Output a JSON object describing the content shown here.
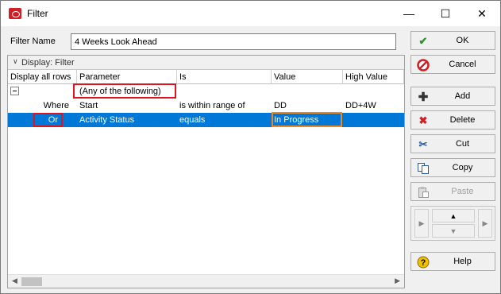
{
  "window": {
    "title": "Filter",
    "minimize_glyph": "—",
    "maximize_glyph": "☐",
    "close_glyph": "✕",
    "accent": "#0078d7"
  },
  "form": {
    "filter_name_label": "Filter Name",
    "filter_name_value": "4 Weeks Look Ahead"
  },
  "panel": {
    "header": "Display: Filter",
    "columns": [
      "Display all rows",
      "Parameter",
      "Is",
      "Value",
      "High Value"
    ],
    "rows": [
      {
        "group_label": "(Any of the following)"
      },
      {
        "conj": "Where",
        "parameter": "Start",
        "is": "is within range of",
        "value": "DD",
        "high_value": "DD+4W"
      },
      {
        "conj": "Or",
        "parameter": "Activity Status",
        "is": "equals",
        "value": "In Progress",
        "high_value": "",
        "selected": true
      }
    ]
  },
  "buttons": {
    "ok": "OK",
    "cancel": "Cancel",
    "add": "Add",
    "delete": "Delete",
    "cut": "Cut",
    "copy": "Copy",
    "paste": "Paste",
    "help": "Help"
  },
  "icons": {
    "ok": "check-icon",
    "cancel": "cancel-icon",
    "add": "plus-icon",
    "delete": "x-icon",
    "cut": "scissors-icon",
    "copy": "copy-icon",
    "paste": "paste-icon",
    "help": "help-icon"
  }
}
